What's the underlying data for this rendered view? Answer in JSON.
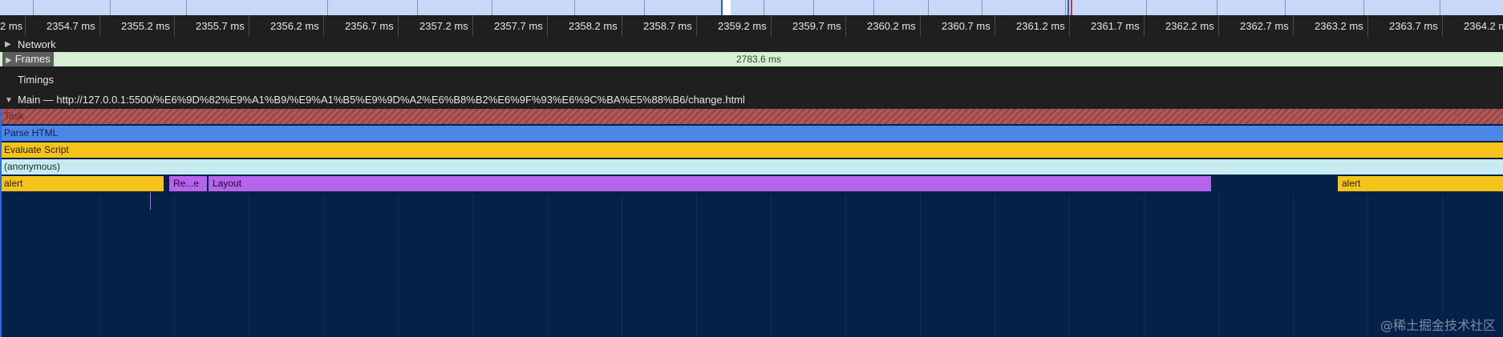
{
  "ruler": {
    "labels": [
      "2 ms",
      "2354.7 ms",
      "2355.2 ms",
      "2355.7 ms",
      "2356.2 ms",
      "2356.7 ms",
      "2357.2 ms",
      "2357.7 ms",
      "2358.2 ms",
      "2358.7 ms",
      "2359.2 ms",
      "2359.7 ms",
      "2360.2 ms",
      "2360.7 ms",
      "2361.2 ms",
      "2361.7 ms",
      "2362.2 ms",
      "2362.7 ms",
      "2363.2 ms",
      "2363.7 ms",
      "2364.2 ms"
    ]
  },
  "tracks": {
    "network": "Network",
    "frames": "Frames",
    "frames_duration": "2783.6 ms",
    "timings": "Timings",
    "main": "Main — http://127.0.0.1:5500/%E6%9D%82%E9%A1%B9/%E9%A1%B5%E9%9D%A2%E6%B8%B2%E6%9F%93%E6%9C%BA%E5%88%B6/change.html"
  },
  "flame": {
    "task": "Task",
    "parse_html": "Parse HTML",
    "evaluate_script": "Evaluate Script",
    "anonymous": "(anonymous)",
    "alert_left": "alert",
    "recalc": "Re...e",
    "layout": "Layout",
    "alert_right": "alert"
  },
  "colors": {
    "task": "#9a4848",
    "parse_html": "#4b86e8",
    "evaluate_script": "#f6c319",
    "anonymous": "#c6ecf1",
    "layout": "#b564eb",
    "frames": "#d6f1d2",
    "background": "#062148"
  },
  "watermark": "@稀土掘金技术社区"
}
